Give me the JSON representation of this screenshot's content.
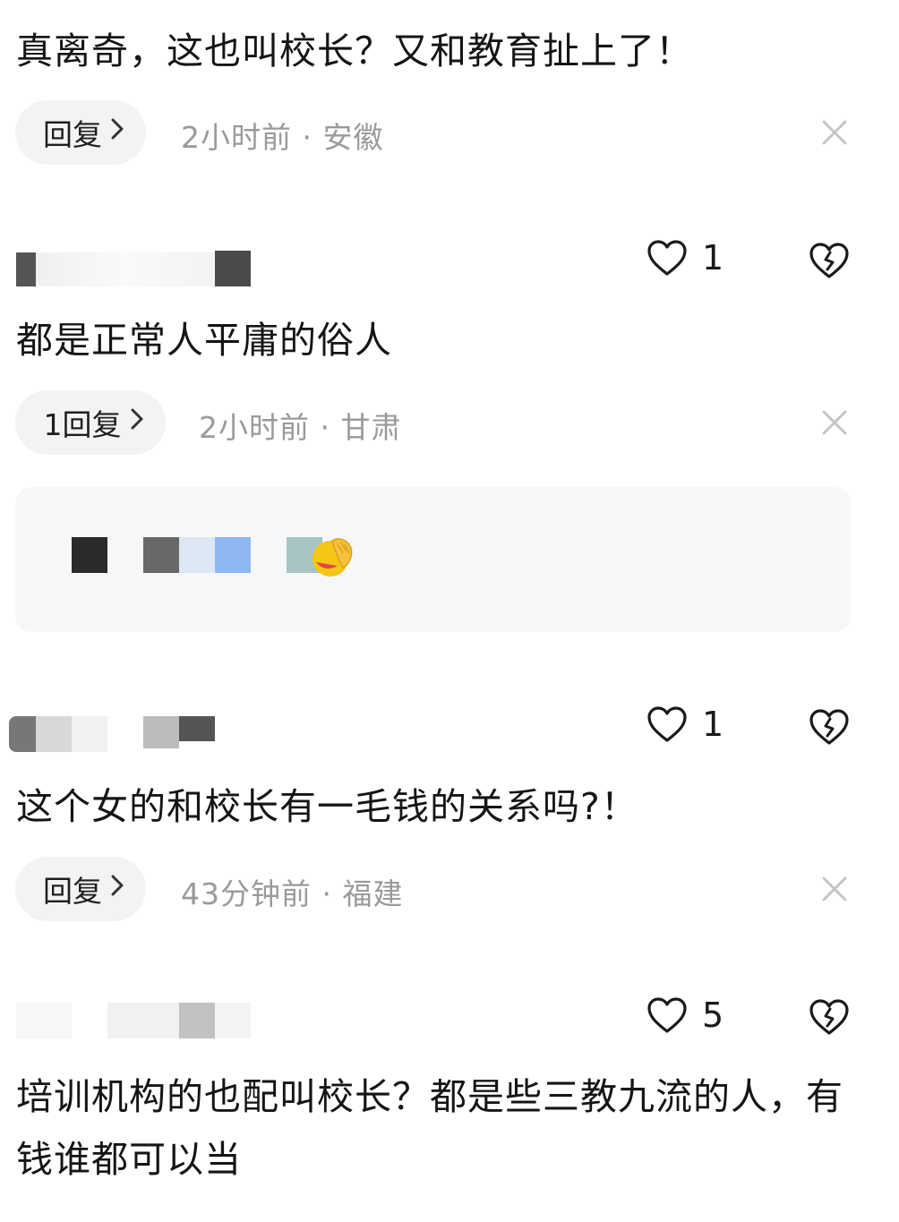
{
  "comments": [
    {
      "text": "真离奇，这也叫校长？又和教育扯上了！",
      "reply_label": "回复",
      "meta": "2小时前 · 安徽"
    },
    {
      "likes": "1",
      "text": "都是正常人平庸的俗人",
      "reply_label": "1回复",
      "meta": "2小时前 · 甘肃"
    },
    {
      "likes": "1",
      "text": "这个女的和校长有一毛钱的关系吗?！",
      "reply_label": "回复",
      "meta": "43分钟前 · 福建"
    },
    {
      "likes": "5",
      "text": "培训机构的也配叫校长？都是些三教九流的人，有钱谁都可以当"
    }
  ],
  "icons": {
    "reply_chevron": "chevron-right-icon",
    "close": "close-icon",
    "like": "heart-outline-icon",
    "dislike": "broken-heart-icon",
    "sub_reply_emoji": "facepalm-emoji"
  },
  "colors": {
    "text": "#151515",
    "meta": "#9a9a9a",
    "pill_bg": "#f2f3f5",
    "subreply_bg": "#f6f7f8"
  }
}
